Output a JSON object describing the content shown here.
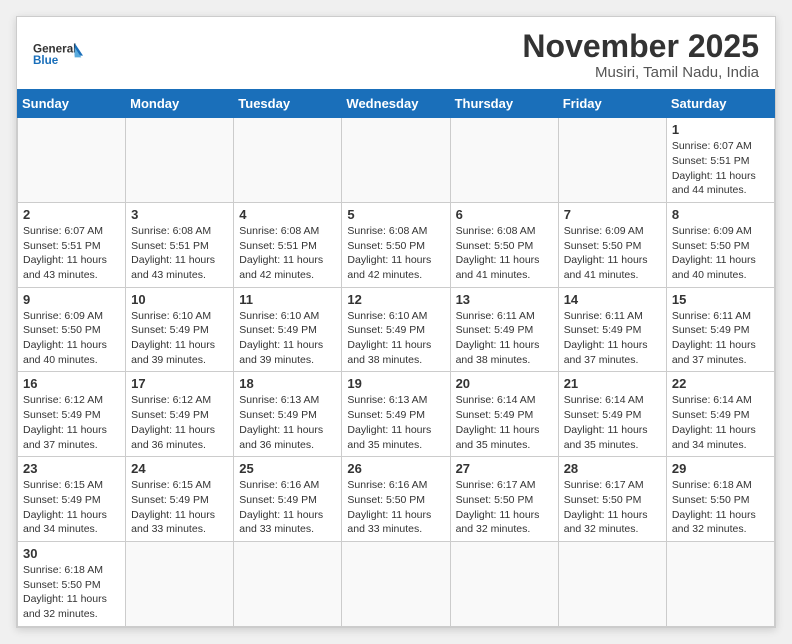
{
  "header": {
    "logo_general": "General",
    "logo_blue": "Blue",
    "month_title": "November 2025",
    "location": "Musiri, Tamil Nadu, India"
  },
  "days_of_week": [
    "Sunday",
    "Monday",
    "Tuesday",
    "Wednesday",
    "Thursday",
    "Friday",
    "Saturday"
  ],
  "weeks": [
    [
      {
        "day": "",
        "info": ""
      },
      {
        "day": "",
        "info": ""
      },
      {
        "day": "",
        "info": ""
      },
      {
        "day": "",
        "info": ""
      },
      {
        "day": "",
        "info": ""
      },
      {
        "day": "",
        "info": ""
      },
      {
        "day": "1",
        "info": "Sunrise: 6:07 AM\nSunset: 5:51 PM\nDaylight: 11 hours\nand 44 minutes."
      }
    ],
    [
      {
        "day": "2",
        "info": "Sunrise: 6:07 AM\nSunset: 5:51 PM\nDaylight: 11 hours\nand 43 minutes."
      },
      {
        "day": "3",
        "info": "Sunrise: 6:08 AM\nSunset: 5:51 PM\nDaylight: 11 hours\nand 43 minutes."
      },
      {
        "day": "4",
        "info": "Sunrise: 6:08 AM\nSunset: 5:51 PM\nDaylight: 11 hours\nand 42 minutes."
      },
      {
        "day": "5",
        "info": "Sunrise: 6:08 AM\nSunset: 5:50 PM\nDaylight: 11 hours\nand 42 minutes."
      },
      {
        "day": "6",
        "info": "Sunrise: 6:08 AM\nSunset: 5:50 PM\nDaylight: 11 hours\nand 41 minutes."
      },
      {
        "day": "7",
        "info": "Sunrise: 6:09 AM\nSunset: 5:50 PM\nDaylight: 11 hours\nand 41 minutes."
      },
      {
        "day": "8",
        "info": "Sunrise: 6:09 AM\nSunset: 5:50 PM\nDaylight: 11 hours\nand 40 minutes."
      }
    ],
    [
      {
        "day": "9",
        "info": "Sunrise: 6:09 AM\nSunset: 5:50 PM\nDaylight: 11 hours\nand 40 minutes."
      },
      {
        "day": "10",
        "info": "Sunrise: 6:10 AM\nSunset: 5:49 PM\nDaylight: 11 hours\nand 39 minutes."
      },
      {
        "day": "11",
        "info": "Sunrise: 6:10 AM\nSunset: 5:49 PM\nDaylight: 11 hours\nand 39 minutes."
      },
      {
        "day": "12",
        "info": "Sunrise: 6:10 AM\nSunset: 5:49 PM\nDaylight: 11 hours\nand 38 minutes."
      },
      {
        "day": "13",
        "info": "Sunrise: 6:11 AM\nSunset: 5:49 PM\nDaylight: 11 hours\nand 38 minutes."
      },
      {
        "day": "14",
        "info": "Sunrise: 6:11 AM\nSunset: 5:49 PM\nDaylight: 11 hours\nand 37 minutes."
      },
      {
        "day": "15",
        "info": "Sunrise: 6:11 AM\nSunset: 5:49 PM\nDaylight: 11 hours\nand 37 minutes."
      }
    ],
    [
      {
        "day": "16",
        "info": "Sunrise: 6:12 AM\nSunset: 5:49 PM\nDaylight: 11 hours\nand 37 minutes."
      },
      {
        "day": "17",
        "info": "Sunrise: 6:12 AM\nSunset: 5:49 PM\nDaylight: 11 hours\nand 36 minutes."
      },
      {
        "day": "18",
        "info": "Sunrise: 6:13 AM\nSunset: 5:49 PM\nDaylight: 11 hours\nand 36 minutes."
      },
      {
        "day": "19",
        "info": "Sunrise: 6:13 AM\nSunset: 5:49 PM\nDaylight: 11 hours\nand 35 minutes."
      },
      {
        "day": "20",
        "info": "Sunrise: 6:14 AM\nSunset: 5:49 PM\nDaylight: 11 hours\nand 35 minutes."
      },
      {
        "day": "21",
        "info": "Sunrise: 6:14 AM\nSunset: 5:49 PM\nDaylight: 11 hours\nand 35 minutes."
      },
      {
        "day": "22",
        "info": "Sunrise: 6:14 AM\nSunset: 5:49 PM\nDaylight: 11 hours\nand 34 minutes."
      }
    ],
    [
      {
        "day": "23",
        "info": "Sunrise: 6:15 AM\nSunset: 5:49 PM\nDaylight: 11 hours\nand 34 minutes."
      },
      {
        "day": "24",
        "info": "Sunrise: 6:15 AM\nSunset: 5:49 PM\nDaylight: 11 hours\nand 33 minutes."
      },
      {
        "day": "25",
        "info": "Sunrise: 6:16 AM\nSunset: 5:49 PM\nDaylight: 11 hours\nand 33 minutes."
      },
      {
        "day": "26",
        "info": "Sunrise: 6:16 AM\nSunset: 5:50 PM\nDaylight: 11 hours\nand 33 minutes."
      },
      {
        "day": "27",
        "info": "Sunrise: 6:17 AM\nSunset: 5:50 PM\nDaylight: 11 hours\nand 32 minutes."
      },
      {
        "day": "28",
        "info": "Sunrise: 6:17 AM\nSunset: 5:50 PM\nDaylight: 11 hours\nand 32 minutes."
      },
      {
        "day": "29",
        "info": "Sunrise: 6:18 AM\nSunset: 5:50 PM\nDaylight: 11 hours\nand 32 minutes."
      }
    ],
    [
      {
        "day": "30",
        "info": "Sunrise: 6:18 AM\nSunset: 5:50 PM\nDaylight: 11 hours\nand 32 minutes."
      },
      {
        "day": "",
        "info": ""
      },
      {
        "day": "",
        "info": ""
      },
      {
        "day": "",
        "info": ""
      },
      {
        "day": "",
        "info": ""
      },
      {
        "day": "",
        "info": ""
      },
      {
        "day": "",
        "info": ""
      }
    ]
  ]
}
